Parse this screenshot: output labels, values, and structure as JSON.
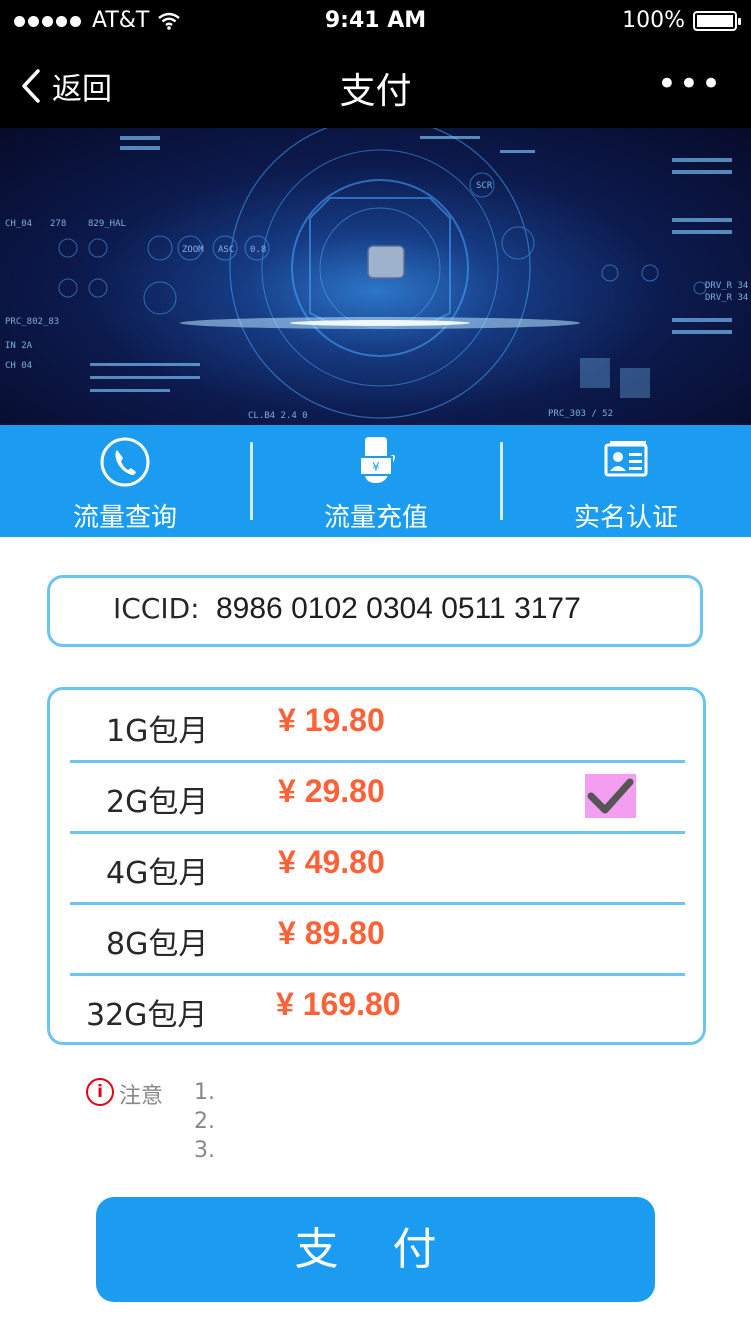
{
  "status_bar": {
    "carrier": "AT&T",
    "time": "9:41 AM",
    "battery": "100%"
  },
  "nav": {
    "back_label": "返回",
    "title": "支付",
    "more_label": "•••"
  },
  "banner": {
    "hud_labels": [
      "CH_04",
      "278",
      "829_HAL",
      "PRC_802_83",
      "SCR",
      "DRV_R 34",
      "IN 2A",
      "CH 04",
      "ZOOM",
      "ASC",
      "0.8",
      "PRC_303 / 52",
      "DRV_R 34",
      "CL.B4 2.4 0"
    ]
  },
  "actions": [
    {
      "label": "流量查询",
      "icon": "phone-icon"
    },
    {
      "label": "流量充值",
      "icon": "hand-yuan-icon"
    },
    {
      "label": "实名认证",
      "icon": "id-card-icon"
    }
  ],
  "iccid": {
    "label": "ICCID:",
    "value": "8986 0102 0304 0511 3177"
  },
  "plans": [
    {
      "name": "1G包月",
      "price": "¥ 19.80"
    },
    {
      "name": "2G包月",
      "price": "¥ 29.80"
    },
    {
      "name": "4G包月",
      "price": "¥ 49.80"
    },
    {
      "name": "8G包月",
      "price": "¥ 89.80"
    },
    {
      "name": "32G包月",
      "price": "¥ 169.80"
    }
  ],
  "selected_plan": "2G包月",
  "note": {
    "label": "注意",
    "items": [
      "1.",
      "2.",
      "3."
    ]
  },
  "pay_button": {
    "label": "支 付"
  },
  "colors": {
    "accent": "#1c9cf0",
    "border": "#6cc4f0",
    "price": "#fc6137",
    "text": "#282828"
  }
}
